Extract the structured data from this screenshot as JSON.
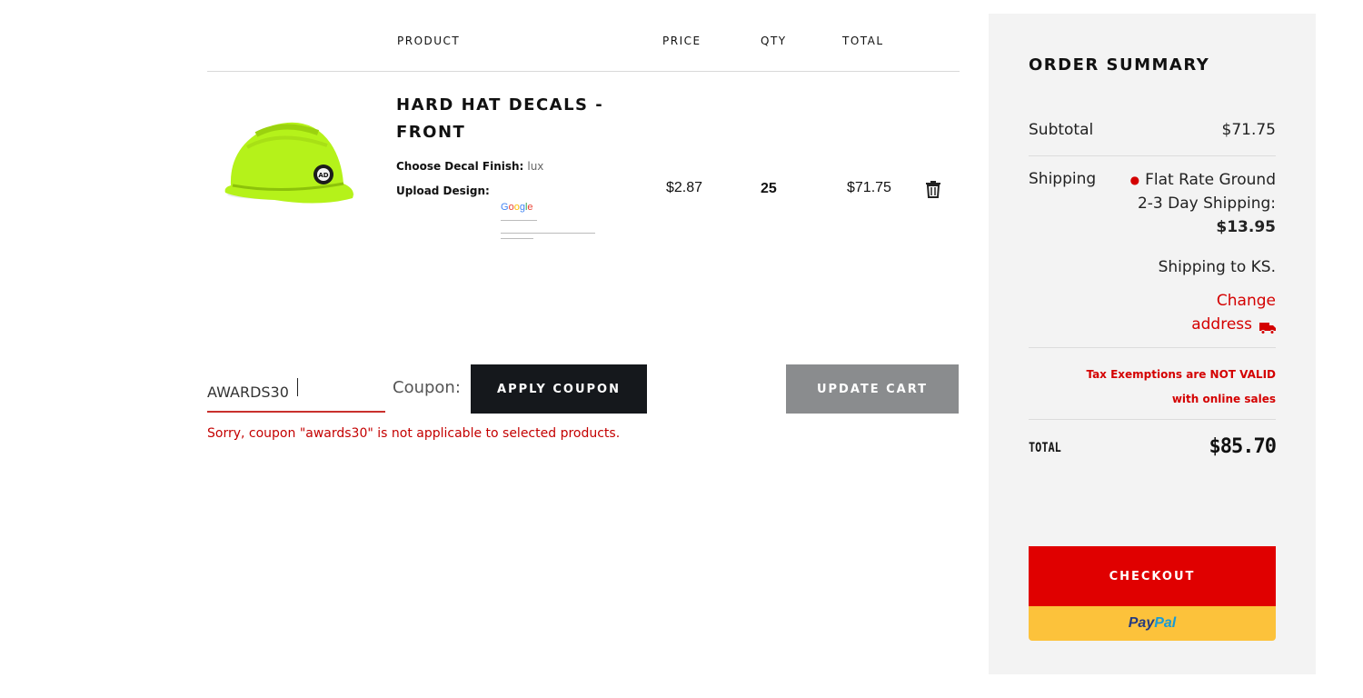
{
  "cart": {
    "headers": {
      "product": "PRODUCT",
      "price": "PRICE",
      "qty": "QTY",
      "total": "TOTAL"
    },
    "item": {
      "name": "HARD HAT DECALS - FRONT",
      "options": [
        {
          "label": "Choose Decal Finish:",
          "value": "lux"
        },
        {
          "label": "Upload Design:",
          "value": ""
        }
      ],
      "design_thumb_text": "Google",
      "price": "$2.87",
      "qty": "25",
      "total": "$71.75",
      "icons": {
        "remove": "trash-icon",
        "product": "hard-hat-image"
      }
    }
  },
  "coupon": {
    "value": "AWARDS30",
    "label": "Coupon:",
    "apply_label": "APPLY COUPON",
    "update_label": "UPDATE CART",
    "error": "Sorry, coupon \"awards30\" is not applicable to selected products."
  },
  "summary": {
    "title": "ORDER SUMMARY",
    "subtotal_label": "Subtotal",
    "subtotal_value": "$71.75",
    "shipping_label": "Shipping",
    "shipping_method_line1": "Flat Rate Ground",
    "shipping_method_line2": "2-3 Day Shipping:",
    "shipping_price": "$13.95",
    "shipping_to": "Shipping to KS.",
    "change_line1": "Change",
    "change_line2": "address",
    "tax_line1": "Tax Exemptions are NOT VALID",
    "tax_line2": "with online sales",
    "total_label": "TOTAL",
    "total_value": "$85.70",
    "checkout_label": "CHECKOUT",
    "paypal_a": "Pay",
    "paypal_b": "Pal"
  },
  "colors": {
    "accent_red": "#e00000",
    "dark_button": "#15181c",
    "gray_button": "#8a8c8e",
    "paypal_yellow": "#fcc23b",
    "panel_bg": "#f3f3f3",
    "hardhat_green": "#b5f21a"
  }
}
